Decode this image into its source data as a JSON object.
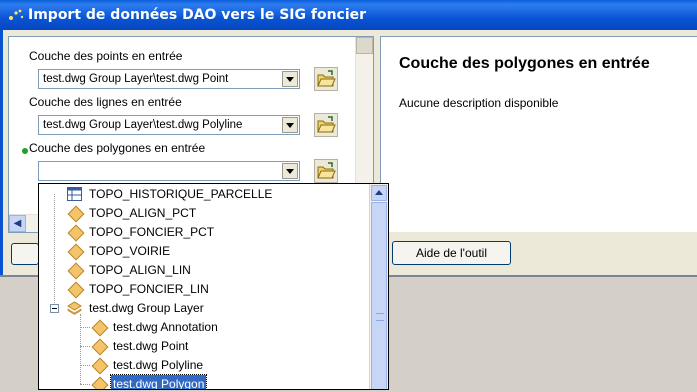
{
  "window": {
    "title": "Import de données DAO vers le SIG foncier"
  },
  "form": {
    "points_label": "Couche des points en entrée",
    "points_value": "test.dwg Group Layer\\test.dwg Point",
    "lines_label": "Couche des lignes en entrée",
    "lines_value": "test.dwg Group Layer\\test.dwg Polyline",
    "polygons_label": "Couche des polygones en entrée",
    "polygons_value": ""
  },
  "help_panel": {
    "title": "Couche des polygones en entrée",
    "description": "Aucune description disponible"
  },
  "buttons": {
    "help": "Aide de l'outil"
  },
  "dropdown": {
    "items": [
      {
        "label": "TOPO_HISTORIQUE_PARCELLE",
        "icon": "table-icon"
      },
      {
        "label": "TOPO_ALIGN_PCT",
        "icon": "layer-diamond-icon"
      },
      {
        "label": "TOPO_FONCIER_PCT",
        "icon": "layer-diamond-icon"
      },
      {
        "label": "TOPO_VOIRIE",
        "icon": "layer-diamond-icon"
      },
      {
        "label": "TOPO_ALIGN_LIN",
        "icon": "layer-diamond-icon"
      },
      {
        "label": "TOPO_FONCIER_LIN",
        "icon": "layer-diamond-icon"
      },
      {
        "label": "test.dwg Group Layer",
        "icon": "group-layer-icon"
      },
      {
        "label": "test.dwg Annotation",
        "icon": "layer-diamond-icon"
      },
      {
        "label": "test.dwg Point",
        "icon": "layer-diamond-icon"
      },
      {
        "label": "test.dwg Polyline",
        "icon": "layer-diamond-icon"
      },
      {
        "label": "test.dwg Polygon",
        "icon": "layer-diamond-icon",
        "selected": true
      }
    ]
  },
  "colors": {
    "selection": "#316ac5",
    "titlebar": "#0a54d4",
    "required_dot": "#22a022"
  }
}
